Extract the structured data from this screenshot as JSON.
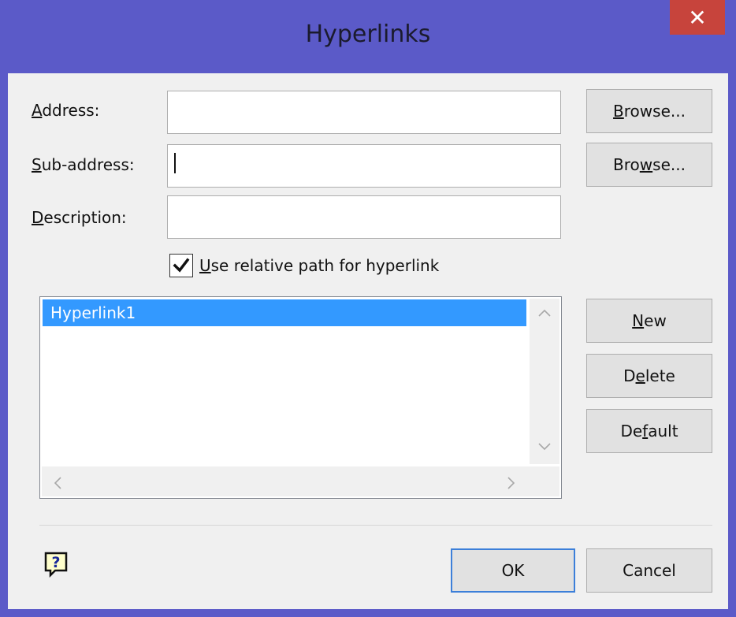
{
  "window": {
    "title": "Hyperlinks",
    "close_glyph": "✕"
  },
  "fields": {
    "address_label_key": "A",
    "address_label_rest": "ddress:",
    "address_value": "",
    "subaddress_label_key": "S",
    "subaddress_label_rest": "ub-address:",
    "subaddress_value": "",
    "description_label_key": "D",
    "description_label_rest": "escription:",
    "description_value": ""
  },
  "buttons": {
    "browse1_key": "B",
    "browse1_rest": "rowse...",
    "browse2_pre": "Bro",
    "browse2_key": "w",
    "browse2_rest": "se...",
    "new_key": "N",
    "new_rest": "ew",
    "delete_pre": "D",
    "delete_key": "e",
    "delete_rest": "lete",
    "default_pre": "De",
    "default_key": "f",
    "default_rest": "ault",
    "ok": "OK",
    "cancel": "Cancel"
  },
  "checkbox": {
    "label_key": "U",
    "label_rest": "se relative path for hyperlink",
    "checked": true
  },
  "list": {
    "items": [
      "Hyperlink1"
    ],
    "selected_index": 0
  },
  "icons": {
    "help": "help-icon",
    "scroll_up": "chevron-up-icon",
    "scroll_down": "chevron-down-icon",
    "scroll_left": "chevron-left-icon",
    "scroll_right": "chevron-right-icon",
    "checkmark": "checkmark-icon"
  },
  "colors": {
    "titlebar": "#5b5ac8",
    "close": "#c7443c",
    "selection": "#3399ff",
    "default_button_border": "#3c7fd9"
  }
}
